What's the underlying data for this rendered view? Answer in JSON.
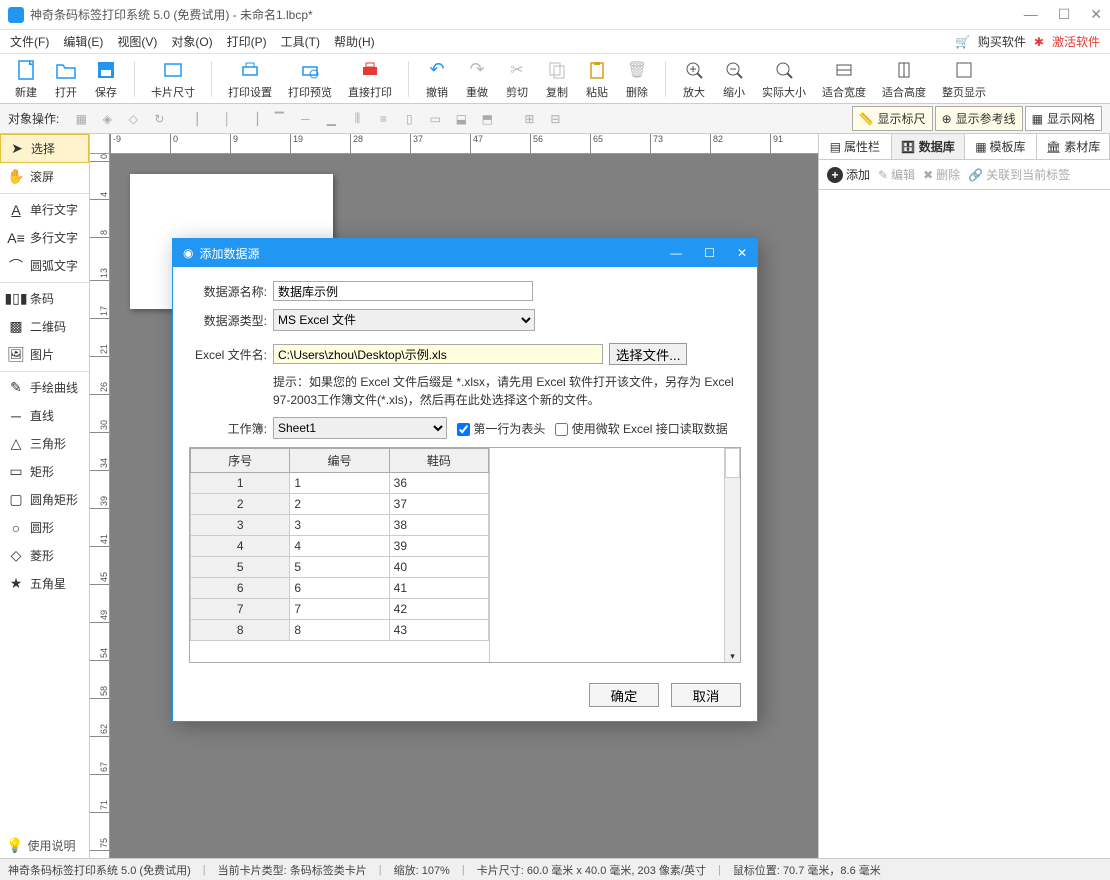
{
  "window": {
    "title": "神奇条码标签打印系统 5.0 (免费试用) - 未命名1.lbcp*"
  },
  "menus": [
    "文件(F)",
    "编辑(E)",
    "视图(V)",
    "对象(O)",
    "打印(P)",
    "工具(T)",
    "帮助(H)"
  ],
  "menu_right": {
    "buy": "购买软件",
    "activate": "激活软件"
  },
  "toolbar": [
    "新建",
    "打开",
    "保存",
    "卡片尺寸",
    "打印设置",
    "打印预览",
    "直接打印",
    "撤销",
    "重做",
    "剪切",
    "复制",
    "粘贴",
    "删除",
    "放大",
    "缩小",
    "实际大小",
    "适合宽度",
    "适合高度",
    "整页显示"
  ],
  "sub_label": "对象操作:",
  "toggle": {
    "ruler": "显示标尺",
    "guides": "显示参考线",
    "grid": "显示网格"
  },
  "tools": {
    "select": "选择",
    "pan": "滚屏",
    "text1": "单行文字",
    "text2": "多行文字",
    "text3": "圆弧文字",
    "barcode": "条码",
    "qrcode": "二维码",
    "image": "图片",
    "draw": "手绘曲线",
    "line": "直线",
    "tri": "三角形",
    "rect": "矩形",
    "rrect": "圆角矩形",
    "circle": "圆形",
    "diamond": "菱形",
    "star": "五角星",
    "help": "使用说明"
  },
  "ruler_h": [
    "-9",
    "0",
    "9",
    "19",
    "28",
    "37",
    "47",
    "56",
    "65",
    "73",
    "82",
    "91"
  ],
  "ruler_v": [
    "0",
    "4",
    "8",
    "13",
    "17",
    "21",
    "26",
    "30",
    "34",
    "39",
    "41",
    "45",
    "49",
    "54",
    "58",
    "62",
    "67",
    "71",
    "75"
  ],
  "right_tabs": [
    "属性栏",
    "数据库",
    "模板库",
    "素材库"
  ],
  "right_actions": {
    "add": "添加",
    "edit": "编辑",
    "delete": "删除",
    "link": "关联到当前标签"
  },
  "dialog": {
    "title": "添加数据源",
    "name_label": "数据源名称:",
    "name_value": "数据库示例",
    "type_label": "数据源类型:",
    "type_value": "MS Excel 文件",
    "file_label": "Excel 文件名:",
    "file_value": "C:\\Users\\zhou\\Desktop\\示例.xls",
    "browse": "选择文件...",
    "hint": "提示：如果您的 Excel 文件后缀是 *.xlsx，请先用 Excel 软件打开该文件，另存为 Excel 97-2003工作簿文件(*.xls)，然后再在此处选择这个新的文件。",
    "sheet_label": "工作簿:",
    "sheet_value": "Sheet1",
    "cb1": "第一行为表头",
    "cb2": "使用微软 Excel 接口读取数据",
    "headers": [
      "序号",
      "编号",
      "鞋码"
    ],
    "rows": [
      [
        "1",
        "1",
        "36"
      ],
      [
        "2",
        "2",
        "37"
      ],
      [
        "3",
        "3",
        "38"
      ],
      [
        "4",
        "4",
        "39"
      ],
      [
        "5",
        "5",
        "40"
      ],
      [
        "6",
        "6",
        "41"
      ],
      [
        "7",
        "7",
        "42"
      ],
      [
        "8",
        "8",
        "43"
      ]
    ],
    "ok": "确定",
    "cancel": "取消"
  },
  "status": {
    "app": "神奇条码标签打印系统 5.0 (免费试用)",
    "card_type_label": "当前卡片类型:",
    "card_type": "条码标签类卡片",
    "zoom_label": "缩放:",
    "zoom": "107%",
    "size_label": "卡片尺寸:",
    "size": "60.0 毫米 x 40.0 毫米, 203 像素/英寸",
    "mouse_label": "鼠标位置:",
    "mouse": "70.7 毫米，8.6 毫米"
  }
}
